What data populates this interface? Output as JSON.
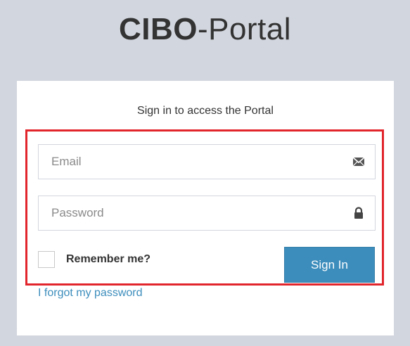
{
  "logo": {
    "bold": "CIBO",
    "light": "-Portal"
  },
  "login": {
    "message": "Sign in to access the Portal",
    "email": {
      "placeholder": "Email",
      "value": "",
      "icon": "envelope-icon"
    },
    "password": {
      "placeholder": "Password",
      "value": "",
      "icon": "lock-icon"
    },
    "remember_label": "Remember me?",
    "remember_checked": false,
    "signin_label": "Sign In",
    "forgot_label": "I forgot my password"
  },
  "colors": {
    "page_background": "#d2d6de",
    "primary_button": "#3c8dbc",
    "link": "#3c8dbc",
    "highlight_border": "#e2252c"
  }
}
